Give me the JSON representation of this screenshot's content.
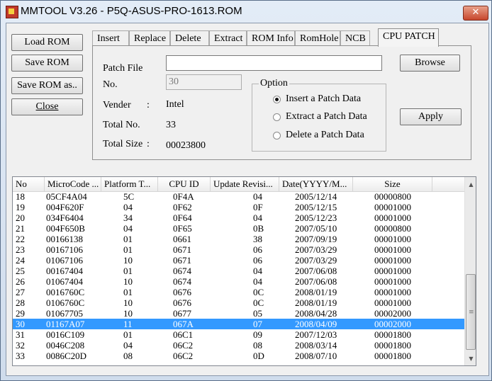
{
  "window": {
    "title": "MMTOOL V3.26 - P5Q-ASUS-PRO-1613.ROM",
    "close_glyph": "✕"
  },
  "left_buttons": {
    "load": "Load ROM",
    "save": "Save ROM",
    "save_as": "Save ROM as..",
    "close": "Close"
  },
  "tabs": [
    "Insert",
    "Replace",
    "Delete",
    "Extract",
    "ROM Info",
    "RomHole",
    "NCB",
    "CPU PATCH"
  ],
  "active_tab": "CPU PATCH",
  "patch": {
    "patch_file_label": "Patch File",
    "patch_file_value": "",
    "no_label": "No.",
    "no_value": "30",
    "browse": "Browse",
    "vender_label": "Vender",
    "vender_sep": ":",
    "vender_value": "Intel",
    "total_no_label": "Total No.",
    "total_no_value": "33",
    "total_size_label": "Total Size",
    "total_size_sep": ":",
    "total_size_value": "00023800",
    "apply": "Apply"
  },
  "option": {
    "legend": "Option",
    "items": [
      {
        "label": "Insert a Patch Data",
        "checked": true
      },
      {
        "label": "Extract a Patch Data",
        "checked": false
      },
      {
        "label": "Delete a Patch Data",
        "checked": false
      }
    ]
  },
  "table": {
    "columns": [
      "No",
      "MicroCode ...",
      "Platform T...",
      "CPU ID",
      "Update Revisi...",
      "Date(YYYY/M...",
      "Size"
    ],
    "selected_no": "30",
    "rows": [
      [
        "18",
        "05CF4A04",
        "5C",
        "0F4A",
        "04",
        "2005/12/14",
        "00000800"
      ],
      [
        "19",
        "004F620F",
        "04",
        "0F62",
        "0F",
        "2005/12/15",
        "00001000"
      ],
      [
        "20",
        "034F6404",
        "34",
        "0F64",
        "04",
        "2005/12/23",
        "00001000"
      ],
      [
        "21",
        "004F650B",
        "04",
        "0F65",
        "0B",
        "2007/05/10",
        "00000800"
      ],
      [
        "22",
        "00166138",
        "01",
        "0661",
        "38",
        "2007/09/19",
        "00001000"
      ],
      [
        "23",
        "00167106",
        "01",
        "0671",
        "06",
        "2007/03/29",
        "00001000"
      ],
      [
        "24",
        "01067106",
        "10",
        "0671",
        "06",
        "2007/03/29",
        "00001000"
      ],
      [
        "25",
        "00167404",
        "01",
        "0674",
        "04",
        "2007/06/08",
        "00001000"
      ],
      [
        "26",
        "01067404",
        "10",
        "0674",
        "04",
        "2007/06/08",
        "00001000"
      ],
      [
        "27",
        "0016760C",
        "01",
        "0676",
        "0C",
        "2008/01/19",
        "00001000"
      ],
      [
        "28",
        "0106760C",
        "10",
        "0676",
        "0C",
        "2008/01/19",
        "00001000"
      ],
      [
        "29",
        "01067705",
        "10",
        "0677",
        "05",
        "2008/04/28",
        "00002000"
      ],
      [
        "30",
        "01167A07",
        "11",
        "067A",
        "07",
        "2008/04/09",
        "00002000"
      ],
      [
        "31",
        "0016C109",
        "01",
        "06C1",
        "09",
        "2007/12/03",
        "00001800"
      ],
      [
        "32",
        "0046C208",
        "04",
        "06C2",
        "08",
        "2008/03/14",
        "00001800"
      ],
      [
        "33",
        "0086C20D",
        "08",
        "06C2",
        "0D",
        "2008/07/10",
        "00001800"
      ]
    ]
  },
  "scrollbar": {
    "up_glyph": "▲",
    "down_glyph": "▼",
    "grip_glyph": "≡"
  }
}
